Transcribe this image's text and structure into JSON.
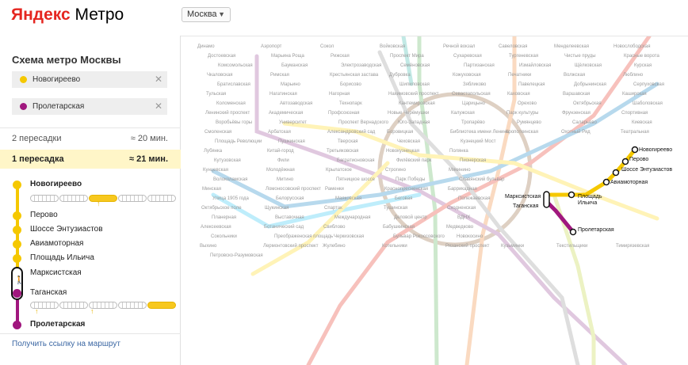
{
  "header": {
    "logo_ya": "Яндекс",
    "logo_rest": "Метро",
    "city": "Москва"
  },
  "panel": {
    "title": "Схема метро Москвы",
    "from": {
      "value": "Новогиреево",
      "color": "#f5c800"
    },
    "to": {
      "value": "Пролетарская",
      "color": "#a0177e"
    },
    "routes": [
      {
        "transfers": "2 пересадки",
        "time": "≈ 20 мин."
      },
      {
        "transfers": "1 пересадка",
        "time": "≈ 21 мин."
      }
    ],
    "steps": {
      "start": "Новогиреево",
      "yellow": [
        "Перово",
        "Шоссе Энтузиастов",
        "Авиамоторная",
        "Площадь Ильича"
      ],
      "transfer_from": "Марксистская",
      "transfer_to": "Таганская",
      "end": "Пролетарская"
    },
    "link": "Получить ссылку на маршрут"
  },
  "colors": {
    "yellow": "#f5c800",
    "purple": "#a0177e",
    "selected_bg": "#fff6c8",
    "brand": "#e52620"
  },
  "icons": [
    "close-icon",
    "chevron-down-icon",
    "walking-person-icon",
    "train-icon"
  ],
  "map": {
    "route_labels": {
      "novogireevo": "Новогиреево",
      "perovo": "Перово",
      "shosse": "Шоссе Энтузиастов",
      "aviamotornaya": "Авиамоторная",
      "ilyicha": "Площадь\nИльича",
      "ilyicha_1": "Площадь",
      "ilyicha_2": "Ильича",
      "marksistskaya": "Марксистская",
      "taganskaya": "Таганская",
      "proletarskaya": "Пролетарская"
    },
    "stations": [
      "Динамо",
      "Аэропорт",
      "Сокол",
      "Войковская",
      "Речной вокзал",
      "Савеловская",
      "Менделеевская",
      "Новослободская",
      "Достоевская",
      "Марьина Роща",
      "Рижская",
      "Проспект Мира",
      "Сухаревская",
      "Тургеневская",
      "Чистые пруды",
      "Красные ворота",
      "Комсомольская",
      "Бауманская",
      "Электрозаводская",
      "Семёновская",
      "Партизанская",
      "Измайловская",
      "Щёлковская",
      "Курская",
      "Чкаловская",
      "Римская",
      "Крестьянская застава",
      "Дубровка",
      "Кожуховская",
      "Печатники",
      "Волжская",
      "Люблино",
      "Братиславская",
      "Марьино",
      "Борисово",
      "Шипиловская",
      "Зябликово",
      "Павелецкая",
      "Добрынинская",
      "Серпуховская",
      "Тульская",
      "Нагатинская",
      "Нагорная",
      "Нахимовский проспект",
      "Севастопольская",
      "Каховская",
      "Варшавская",
      "Каширская",
      "Коломенская",
      "Автозаводская",
      "Технопарк",
      "Кантемировская",
      "Царицыно",
      "Орехово",
      "Октябрьская",
      "Шаболовская",
      "Ленинский проспект",
      "Академическая",
      "Профсоюзная",
      "Новые Черёмушки",
      "Калужская",
      "Парк культуры",
      "Фрунзенская",
      "Спортивная",
      "Воробьёвы горы",
      "Университет",
      "Проспект Вернадского",
      "Юго-Западная",
      "Тропарёво",
      "Румянцево",
      "Саларьево",
      "Киевская",
      "Смоленская",
      "Арбатская",
      "Александровский сад",
      "Боровицкая",
      "Библиотека имени Ленина",
      "Кропоткинская",
      "Охотный Ряд",
      "Театральная",
      "Площадь Революции",
      "Пушкинская",
      "Тверская",
      "Чеховская",
      "Кузнецкий Мост",
      "Лубянка",
      "Китай-город",
      "Третьяковская",
      "Новокузнецкая",
      "Полянка",
      "Кутузовская",
      "Фили",
      "Багратионовская",
      "Филёвский парк",
      "Пионерская",
      "Кунцевская",
      "Молодёжная",
      "Крылатское",
      "Строгино",
      "Мякинино",
      "Волоколамская",
      "Митино",
      "Пятницкое шоссе",
      "Парк Победы",
      "Славянский бульвар",
      "Минская",
      "Ломоносовский проспект",
      "Раменки",
      "Краснопресненская",
      "Баррикадная",
      "Улица 1905 года",
      "Белорусская",
      "Маяковская",
      "Беговая",
      "Полежаевская",
      "Октябрьское поле",
      "Щукинская",
      "Спартак",
      "Тушинская",
      "Сходненская",
      "Планерная",
      "Выставочная",
      "Международная",
      "Деловой центр",
      "ВДНХ",
      "Алексеевская",
      "Ботанический сад",
      "Свиблово",
      "Бабушкинская",
      "Медведково",
      "Сокольники",
      "Преображенская площадь",
      "Черкизовская",
      "Бульвар Рокоссовского",
      "Новокосино",
      "Выхино",
      "Лермонтовский проспект",
      "Жулебино",
      "Котельники",
      "Рязанский проспект",
      "Кузьминки",
      "Текстильщики",
      "Тимирязевская",
      "Петровско-Разумовская"
    ]
  }
}
